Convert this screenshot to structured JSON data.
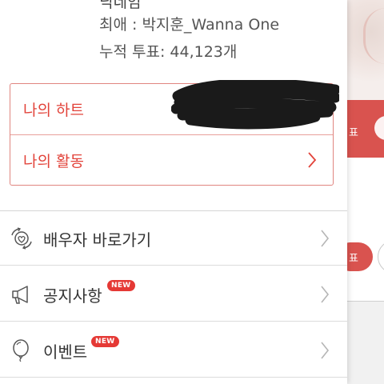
{
  "profile": {
    "name_partial": "닉네임",
    "favorite": "최애 : 박지훈_Wanna One",
    "votes": "누적 투표: 44,123개"
  },
  "highlight_box": {
    "items": [
      {
        "label": "나의 하트"
      },
      {
        "label": "나의 활동"
      }
    ]
  },
  "menu": {
    "items": [
      {
        "label": "배우자 바로가기",
        "icon": "heart-swap-icon",
        "badge": ""
      },
      {
        "label": "공지사항",
        "icon": "megaphone-icon",
        "badge": "NEW"
      },
      {
        "label": "이벤트",
        "icon": "balloon-icon",
        "badge": "NEW"
      }
    ]
  },
  "background_app": {
    "red_band_text": "표",
    "pill_text": "표"
  },
  "colors": {
    "accent_red": "#e2433a",
    "badge_red": "#e53935",
    "box_border": "#e08580"
  }
}
